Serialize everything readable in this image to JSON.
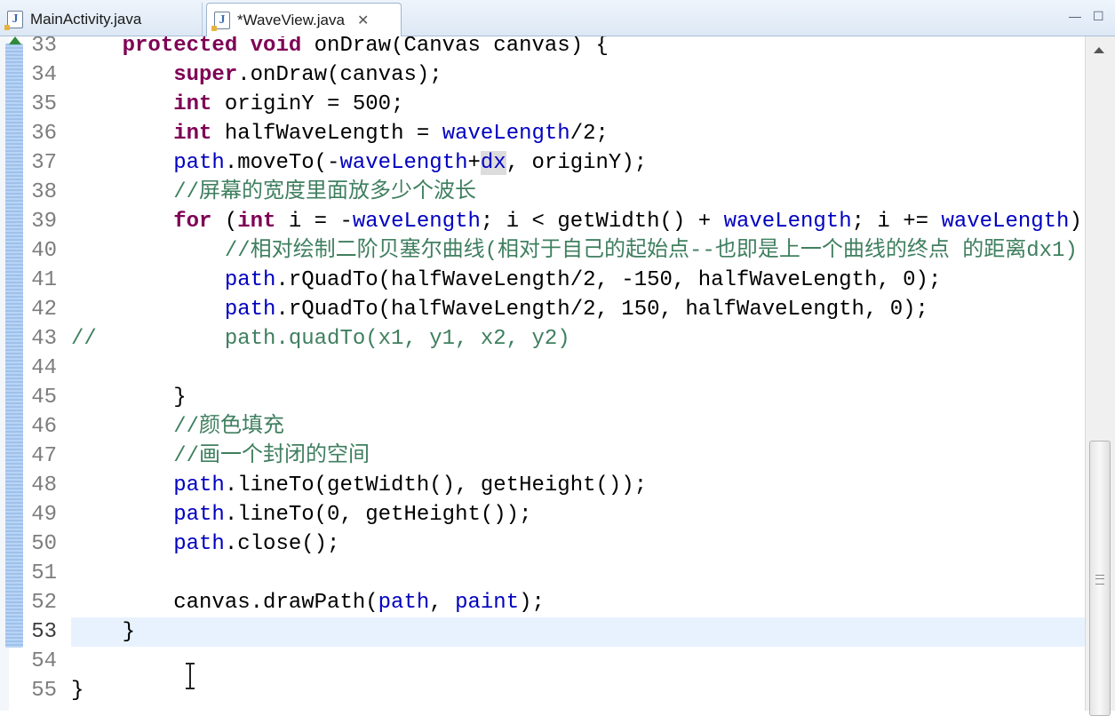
{
  "tabs": [
    {
      "label": "MainActivity.java",
      "active": false
    },
    {
      "label": "*WaveView.java",
      "active": true
    }
  ],
  "window_controls": {
    "minimize": "—",
    "maximize": "☐"
  },
  "editor": {
    "first_line": 33,
    "current_line": 53,
    "lines": [
      {
        "num": "33",
        "tokens": [
          [
            "    ",
            ""
          ],
          [
            "protected",
            "kw"
          ],
          [
            " ",
            ""
          ],
          [
            "void",
            "kw"
          ],
          [
            " onDraw(Canvas canvas) {",
            ""
          ]
        ]
      },
      {
        "num": "34",
        "tokens": [
          [
            "        ",
            ""
          ],
          [
            "super",
            "kw"
          ],
          [
            ".onDraw(canvas);",
            ""
          ]
        ]
      },
      {
        "num": "35",
        "tokens": [
          [
            "        ",
            ""
          ],
          [
            "int",
            "kw"
          ],
          [
            " originY = 500;",
            ""
          ]
        ]
      },
      {
        "num": "36",
        "tokens": [
          [
            "        ",
            ""
          ],
          [
            "int",
            "kw"
          ],
          [
            " halfWaveLength = ",
            ""
          ],
          [
            "waveLength",
            "fld"
          ],
          [
            "/2;",
            ""
          ]
        ]
      },
      {
        "num": "37",
        "tokens": [
          [
            "        ",
            ""
          ],
          [
            "path",
            "fld"
          ],
          [
            ".moveTo(-",
            ""
          ],
          [
            "waveLength",
            "fld"
          ],
          [
            "+",
            ""
          ],
          [
            "dx",
            "fld hl"
          ],
          [
            ", originY);",
            ""
          ]
        ]
      },
      {
        "num": "38",
        "tokens": [
          [
            "        ",
            ""
          ],
          [
            "//屏幕的宽度里面放多少个波长",
            "cmt"
          ]
        ]
      },
      {
        "num": "39",
        "tokens": [
          [
            "        ",
            ""
          ],
          [
            "for",
            "kw"
          ],
          [
            " (",
            ""
          ],
          [
            "int",
            "kw"
          ],
          [
            " i = -",
            ""
          ],
          [
            "waveLength",
            "fld"
          ],
          [
            "; i < getWidth() + ",
            ""
          ],
          [
            "waveLength",
            "fld"
          ],
          [
            "; i += ",
            ""
          ],
          [
            "waveLength",
            "fld"
          ],
          [
            ") {",
            ""
          ]
        ]
      },
      {
        "num": "40",
        "tokens": [
          [
            "            ",
            ""
          ],
          [
            "//相对绘制二阶贝塞尔曲线(相对于自己的起始点--也即是上一个曲线的终点 的距离dx1)",
            "cmt"
          ]
        ]
      },
      {
        "num": "41",
        "tokens": [
          [
            "            ",
            ""
          ],
          [
            "path",
            "fld"
          ],
          [
            ".rQuadTo(halfWaveLength/2, -150, halfWaveLength, 0);",
            ""
          ]
        ]
      },
      {
        "num": "42",
        "tokens": [
          [
            "            ",
            ""
          ],
          [
            "path",
            "fld"
          ],
          [
            ".rQuadTo(halfWaveLength/2, 150, halfWaveLength, 0);",
            ""
          ]
        ]
      },
      {
        "num": "43",
        "tokens": [
          [
            "//          path.quadTo(x1, y1, x2, y2)",
            "cmt"
          ]
        ]
      },
      {
        "num": "44",
        "tokens": []
      },
      {
        "num": "45",
        "tokens": [
          [
            "        }",
            ""
          ]
        ]
      },
      {
        "num": "46",
        "tokens": [
          [
            "        ",
            ""
          ],
          [
            "//颜色填充",
            "cmt"
          ]
        ]
      },
      {
        "num": "47",
        "tokens": [
          [
            "        ",
            ""
          ],
          [
            "//画一个封闭的空间",
            "cmt"
          ]
        ]
      },
      {
        "num": "48",
        "tokens": [
          [
            "        ",
            ""
          ],
          [
            "path",
            "fld"
          ],
          [
            ".lineTo(getWidth(), getHeight());",
            ""
          ]
        ]
      },
      {
        "num": "49",
        "tokens": [
          [
            "        ",
            ""
          ],
          [
            "path",
            "fld"
          ],
          [
            ".lineTo(0, getHeight());",
            ""
          ]
        ]
      },
      {
        "num": "50",
        "tokens": [
          [
            "        ",
            ""
          ],
          [
            "path",
            "fld"
          ],
          [
            ".close();",
            ""
          ]
        ]
      },
      {
        "num": "51",
        "tokens": []
      },
      {
        "num": "52",
        "tokens": [
          [
            "        canvas.drawPath(",
            ""
          ],
          [
            "path",
            "fld"
          ],
          [
            ", ",
            ""
          ],
          [
            "paint",
            "fld"
          ],
          [
            ");",
            ""
          ]
        ]
      },
      {
        "num": "53",
        "tokens": [
          [
            "    }",
            ""
          ]
        ]
      },
      {
        "num": "54",
        "tokens": []
      },
      {
        "num": "55",
        "tokens": [
          [
            "}",
            ""
          ]
        ]
      }
    ]
  },
  "colors": {
    "keyword": "#7f0055",
    "field": "#0000c0",
    "comment": "#3f7f5f",
    "current_line": "#e8f2fe"
  }
}
